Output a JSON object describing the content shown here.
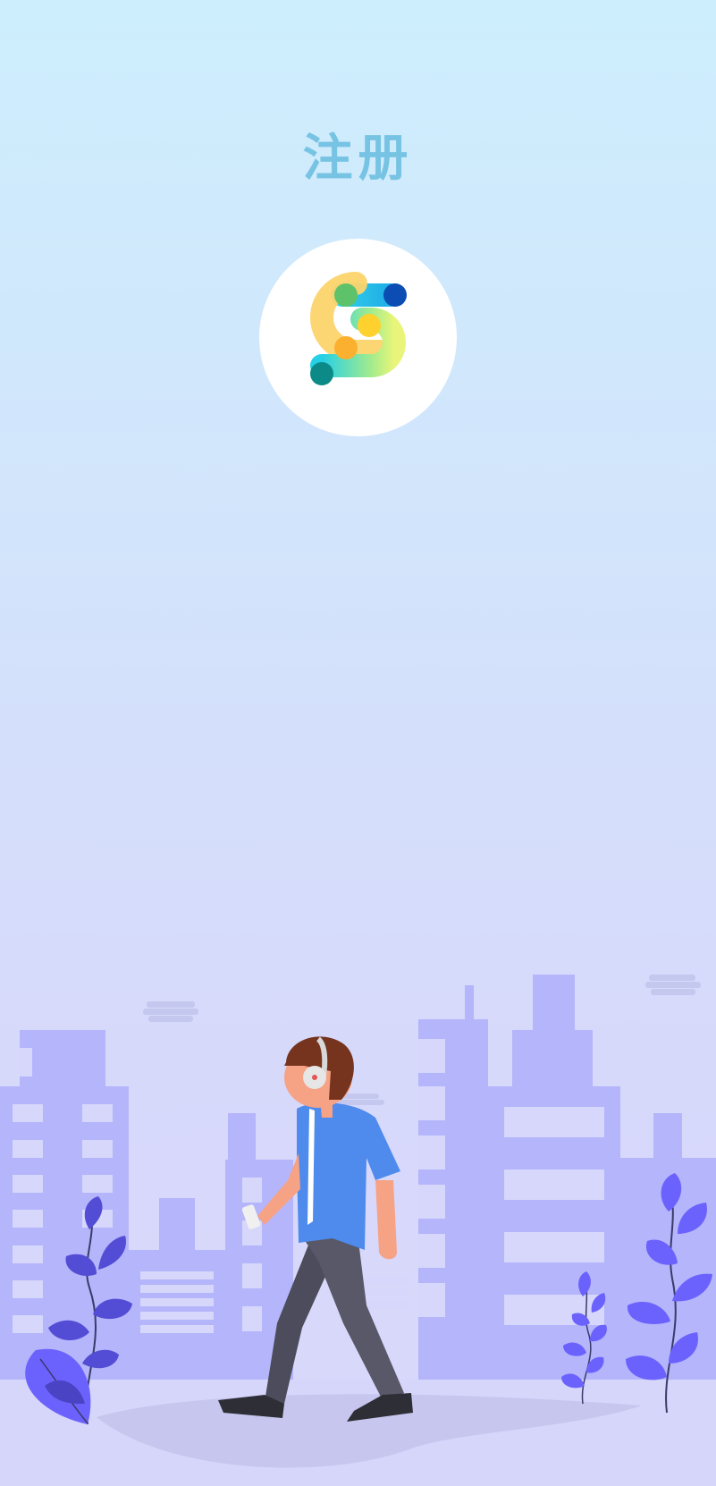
{
  "page": {
    "title": "注册"
  },
  "logo": {
    "icon": "app-logo-s-icon"
  },
  "illustration": {
    "subject": "walking-person-with-headphones-icon",
    "background": "city-skyline-icon"
  },
  "colors": {
    "title": "#77c3e3",
    "buildings": "#b4b5fb",
    "windows": "#d8d9fb",
    "leaves": "#6c63ff",
    "shirt": "#4e8bed",
    "pants": "#545464",
    "hair": "#76341e"
  }
}
